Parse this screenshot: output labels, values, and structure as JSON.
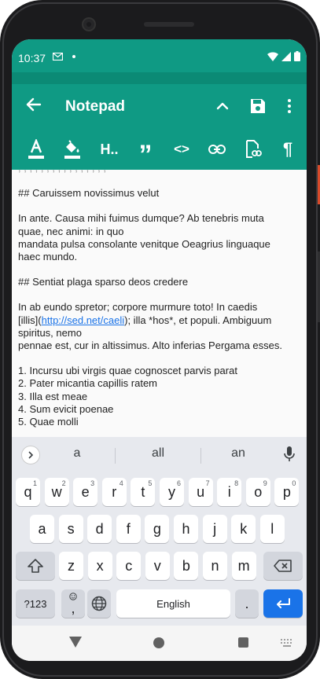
{
  "status": {
    "time": "10:37"
  },
  "app": {
    "title": "Notepad"
  },
  "toolbar": {
    "icons": [
      "text-color-icon",
      "fill-color-icon",
      "heading-icon",
      "quote-icon",
      "code-icon",
      "link-icon",
      "file-link-icon",
      "paragraph-icon"
    ],
    "heading_label": "H..",
    "quote_label": "”",
    "code_label": "<>",
    "paragraph_label": "¶"
  },
  "editor": {
    "lines": [
      "## Caruissem novissimus velut",
      "",
      "In ante. Causa mihi fuimus dumque? Ab tenebris muta",
      "quae, nec animi: in quo",
      "mandata pulsa consolante venitque Oeagrius linguaque",
      "haec mundo.",
      "",
      "## Sentiat plaga sparso deos credere",
      "",
      "In ab eundo spretor; corpore murmure toto! In caedis",
      "[illis](",
      "spiritus, nemo",
      "pennae est, cur in altissimus. Alto inferias Pergama esses.",
      "",
      "1. Incursu ubi virgis quae cognoscet parvis parat",
      "2. Pater micantia capillis ratem",
      "3. Illa est meae",
      "4. Sum evicit poenae",
      "5. Quae molli"
    ],
    "link_text": "http://sed.net/caeli",
    "link_after": "); illa *hos*, et populi. Ambiguum"
  },
  "keyboard": {
    "suggestions": [
      "a",
      "all",
      "an"
    ],
    "row1": [
      {
        "k": "q",
        "h": "1"
      },
      {
        "k": "w",
        "h": "2"
      },
      {
        "k": "e",
        "h": "3"
      },
      {
        "k": "r",
        "h": "4"
      },
      {
        "k": "t",
        "h": "5"
      },
      {
        "k": "y",
        "h": "6"
      },
      {
        "k": "u",
        "h": "7"
      },
      {
        "k": "i",
        "h": "8"
      },
      {
        "k": "o",
        "h": "9"
      },
      {
        "k": "p",
        "h": "0"
      }
    ],
    "row2": [
      "a",
      "s",
      "d",
      "f",
      "g",
      "h",
      "j",
      "k",
      "l"
    ],
    "row3": [
      "z",
      "x",
      "c",
      "v",
      "b",
      "n",
      "m"
    ],
    "sym_label": "?123",
    "comma_label": ",",
    "space_label": "English",
    "period_label": ".",
    "colors": {
      "accent": "#0f9a84",
      "enter": "#1a73e8"
    }
  }
}
